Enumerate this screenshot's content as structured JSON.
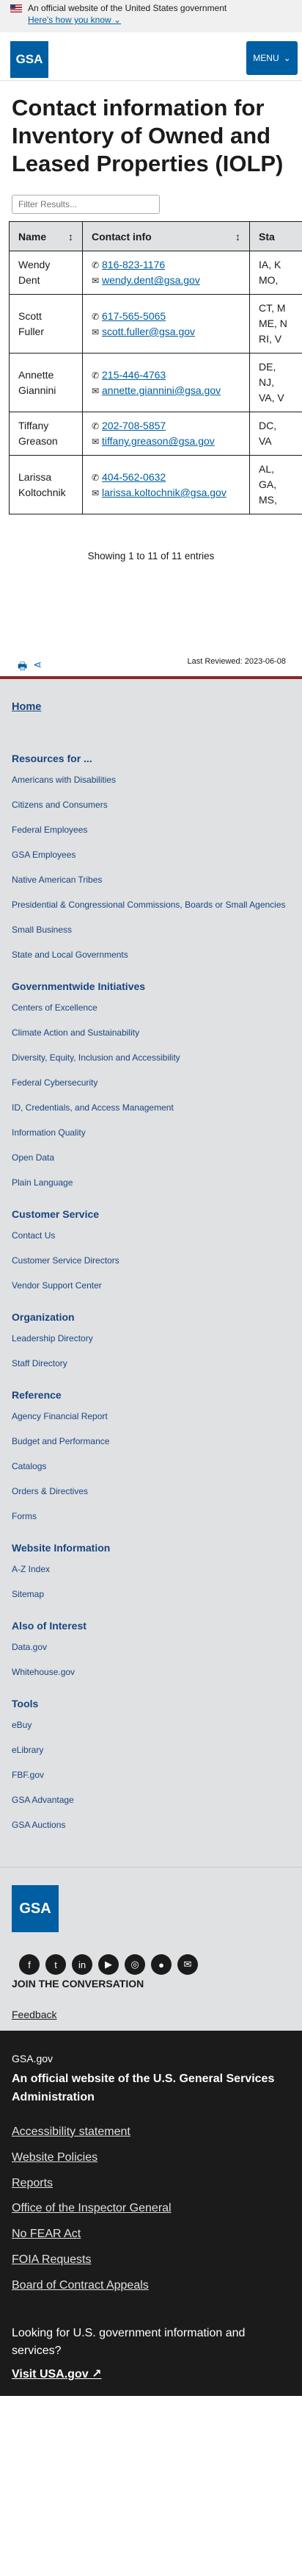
{
  "banner": {
    "text": "An official website of the United States government",
    "how": "Here's how you know"
  },
  "header": {
    "logo": "GSA",
    "menu": "MENU"
  },
  "page": {
    "title": "Contact information for Inventory of Owned and Leased Properties (IOLP)"
  },
  "filter": {
    "placeholder": "Filter Results..."
  },
  "table": {
    "headers": [
      "Name",
      "Contact info",
      "Sta"
    ],
    "rows": [
      {
        "first": "Wendy",
        "last": "Dent",
        "phone": "816-823-1176",
        "email": "wendy.dent@gsa.gov",
        "states": [
          "IA, K",
          "MO,"
        ]
      },
      {
        "first": "Scott",
        "last": "Fuller",
        "phone": "617-565-5065",
        "email": "scott.fuller@gsa.gov",
        "states": [
          "CT, M",
          "ME, N",
          "RI, V"
        ]
      },
      {
        "first": "Annette",
        "last": "Giannini",
        "phone": "215-446-4763",
        "email": "annette.giannini@gsa.gov",
        "states": [
          "DE,",
          "NJ,",
          "VA, V"
        ]
      },
      {
        "first": "Tiffany",
        "last": "Greason",
        "phone": "202-708-5857",
        "email": "tiffany.greason@gsa.gov",
        "states": [
          "DC,",
          "VA"
        ]
      },
      {
        "first": "Larissa",
        "last": "Koltochnik",
        "phone": "404-562-0632",
        "email": "larissa.koltochnik@gsa.gov",
        "states": [
          "AL,",
          "GA,",
          "MS,"
        ]
      }
    ],
    "showing": "Showing 1 to 11 of 11 entries"
  },
  "review": {
    "last": "Last Reviewed: 2023-06-08"
  },
  "footer": {
    "home": "Home",
    "sections": [
      {
        "title": "Resources for ...",
        "links": [
          "Americans with Disabilities",
          "Citizens and Consumers",
          "Federal Employees",
          "GSA Employees",
          "Native American Tribes",
          "Presidential & Congressional Commissions, Boards or Small Agencies",
          "Small Business",
          "State and Local Governments"
        ]
      },
      {
        "title": "Governmentwide Initiatives",
        "links": [
          "Centers of Excellence",
          "Climate Action and Sustainability",
          "Diversity, Equity, Inclusion and Accessibility",
          "Federal Cybersecurity",
          "ID, Credentials, and Access Management",
          "Information Quality",
          "Open Data",
          "Plain Language"
        ]
      },
      {
        "title": "Customer Service",
        "links": [
          "Contact Us",
          "Customer Service Directors",
          "Vendor Support Center"
        ]
      },
      {
        "title": "Organization",
        "links": [
          "Leadership Directory",
          "Staff Directory"
        ]
      },
      {
        "title": "Reference",
        "links": [
          "Agency Financial Report",
          "Budget and Performance",
          "Catalogs",
          "Orders & Directives",
          "Forms"
        ]
      },
      {
        "title": "Website Information",
        "links": [
          "A-Z Index",
          "Sitemap"
        ]
      },
      {
        "title": "Also of Interest",
        "links": [
          "Data.gov",
          "Whitehouse.gov"
        ]
      },
      {
        "title": "Tools",
        "links": [
          "eBuy",
          "eLibrary",
          "FBF.gov",
          "GSA Advantage",
          "GSA Auctions"
        ]
      }
    ]
  },
  "social": {
    "logo": "GSA",
    "icons": [
      "facebook-icon",
      "twitter-icon",
      "linkedin-icon",
      "youtube-icon",
      "instagram-icon",
      "flickr-icon",
      "email-icon"
    ],
    "join": "JOIN THE CONVERSATION",
    "feedback": "Feedback"
  },
  "identifier": {
    "domain": "GSA.gov",
    "tagline": "An official website of the U.S. General Services Administration",
    "links": [
      "Accessibility statement",
      "Website Policies",
      "Reports",
      "Office of the Inspector General",
      "No FEAR Act",
      "FOIA Requests",
      "Board of Contract Appeals"
    ],
    "looking": "Looking for U.S. government information and services?",
    "visit": "Visit USA.gov"
  }
}
